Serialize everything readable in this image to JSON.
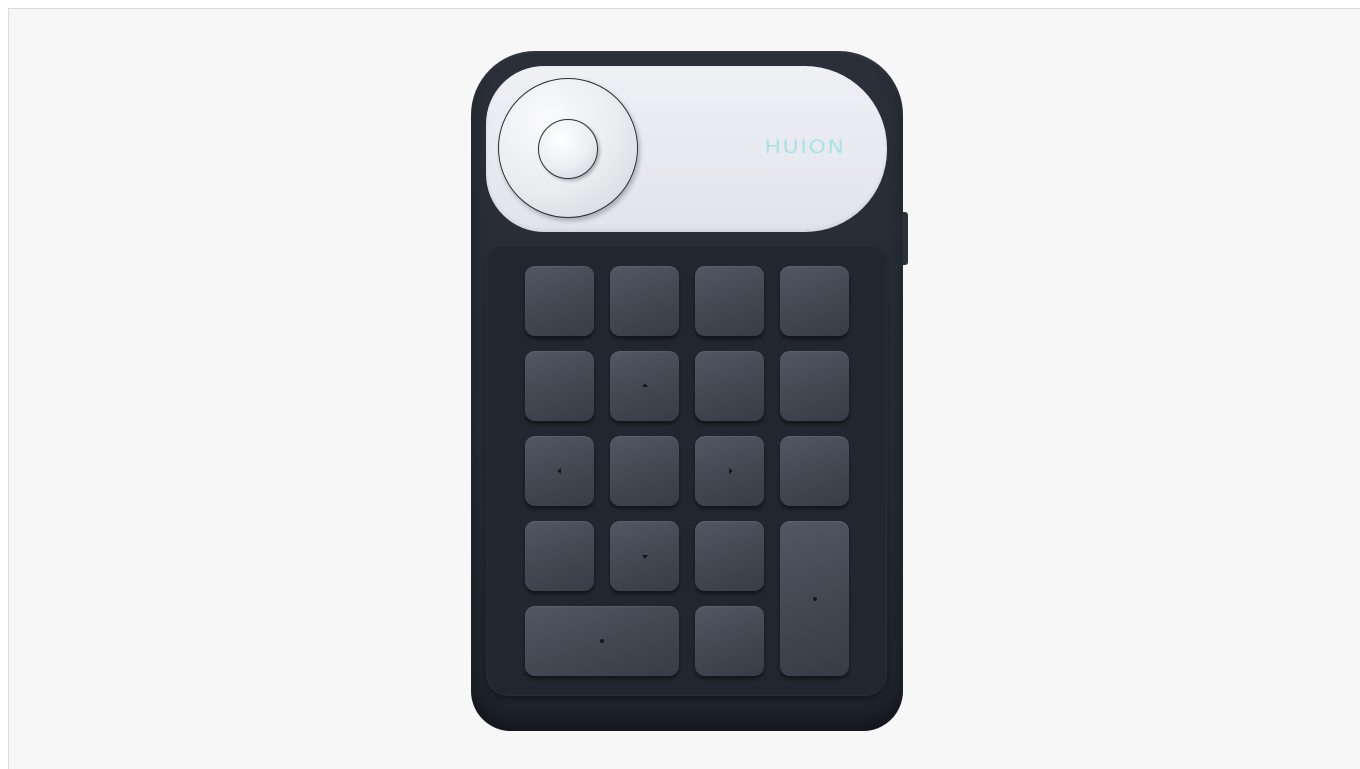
{
  "device": {
    "brand_logo": "HUION",
    "colors": {
      "body": "#252a33",
      "top_panel": "#e6e8ee",
      "keys": "#464a55",
      "logo": "#a7e3e6"
    },
    "dial": {
      "outer_ring_icon": "dial-ring-icon",
      "center_button_icon": "dial-center-button-icon"
    },
    "keys": [
      {
        "id": "r1c1",
        "mark": "none"
      },
      {
        "id": "r1c2",
        "mark": "none"
      },
      {
        "id": "r1c3",
        "mark": "none"
      },
      {
        "id": "r1c4",
        "mark": "none"
      },
      {
        "id": "r2c1",
        "mark": "none"
      },
      {
        "id": "r2c2",
        "mark": "arrow-up"
      },
      {
        "id": "r2c3",
        "mark": "none"
      },
      {
        "id": "r2c4",
        "mark": "none"
      },
      {
        "id": "r3c1",
        "mark": "arrow-left"
      },
      {
        "id": "r3c2",
        "mark": "none"
      },
      {
        "id": "r3c3",
        "mark": "arrow-right"
      },
      {
        "id": "r3c4",
        "mark": "none"
      },
      {
        "id": "r4c1",
        "mark": "none"
      },
      {
        "id": "r4c2",
        "mark": "arrow-down"
      },
      {
        "id": "r4c3",
        "mark": "none"
      },
      {
        "id": "tall-right",
        "mark": "dot"
      },
      {
        "id": "wide-bottom",
        "mark": "dot"
      },
      {
        "id": "r5c3",
        "mark": "none"
      }
    ]
  }
}
